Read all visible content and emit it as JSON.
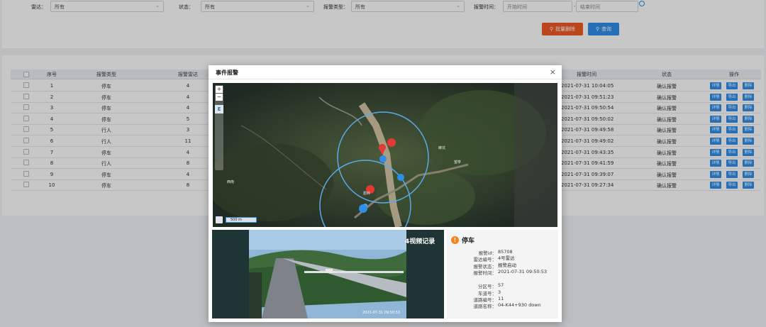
{
  "filters": {
    "radar": {
      "label": "雷达：",
      "value": "所有"
    },
    "status": {
      "label": "状态：",
      "value": "所有"
    },
    "alarm_type": {
      "label": "报警类型：",
      "value": "所有"
    },
    "alarm_time": {
      "label": "报警时间：",
      "start_placeholder": "开始时间",
      "end_placeholder": "结束时间"
    }
  },
  "buttons": {
    "batch_delete": "批量删除",
    "query": "查询"
  },
  "table": {
    "headers": {
      "index": "序号",
      "type": "报警类型",
      "radar": "报警雷达",
      "time": "报警时间",
      "status": "状态",
      "ops": "操作"
    },
    "op_labels": {
      "detail": "详情",
      "export": "导出",
      "delete": "删除"
    },
    "rows": [
      {
        "index": "1",
        "type": "停车",
        "radar": "4",
        "time": "2021-07-31 10:04:05",
        "status": "确认报警"
      },
      {
        "index": "2",
        "type": "停车",
        "radar": "4",
        "time": "2021-07-31 09:51:23",
        "status": "确认报警"
      },
      {
        "index": "3",
        "type": "停车",
        "radar": "4",
        "time": "2021-07-31 09:50:54",
        "status": "确认报警"
      },
      {
        "index": "4",
        "type": "停车",
        "radar": "5",
        "time": "2021-07-31 09:50:02",
        "status": "确认报警"
      },
      {
        "index": "5",
        "type": "行人",
        "radar": "3",
        "time": "2021-07-31 09:49:58",
        "status": "确认报警"
      },
      {
        "index": "6",
        "type": "行人",
        "radar": "11",
        "time": "2021-07-31 09:49:02",
        "status": "确认报警"
      },
      {
        "index": "7",
        "type": "停车",
        "radar": "4",
        "time": "2021-07-31 09:43:35",
        "status": "确认报警"
      },
      {
        "index": "8",
        "type": "行人",
        "radar": "8",
        "time": "2021-07-31 09:41:59",
        "status": "确认报警"
      },
      {
        "index": "9",
        "type": "停车",
        "radar": "4",
        "time": "2021-07-31 09:39:07",
        "status": "确认报警"
      },
      {
        "index": "10",
        "type": "停车",
        "radar": "8",
        "time": "2021-07-31 09:27:34",
        "status": "确认报警"
      }
    ]
  },
  "dialog": {
    "title": "事件报警",
    "close": "×",
    "map": {
      "zoom_in": "+",
      "zoom_out": "−",
      "layer": "E",
      "scale": "500 m",
      "place1": "碧岭",
      "place2": "麻坑",
      "place3": "西南",
      "place4": "望亭"
    },
    "video": {
      "label": "4视频记录",
      "timestamp": "2021-07-31 09:50:53"
    },
    "info": {
      "title": "停车",
      "fields": [
        {
          "k": "报警id：",
          "v": "85708"
        },
        {
          "k": "雷达编号：",
          "v": "4号雷达"
        },
        {
          "k": "报警状态：",
          "v": "报警启动"
        },
        {
          "k": "报警时间：",
          "v": "2021-07-31 09:50:53"
        },
        {
          "k": "分区号：",
          "v": "57"
        },
        {
          "k": "车道号：",
          "v": "3"
        },
        {
          "k": "道路编号：",
          "v": "11"
        },
        {
          "k": "道路名称：",
          "v": "04-K44+930 down"
        }
      ]
    }
  },
  "colors": {
    "primary": "#2f8fe8",
    "danger": "#f05a24",
    "warning": "#f5821f"
  }
}
